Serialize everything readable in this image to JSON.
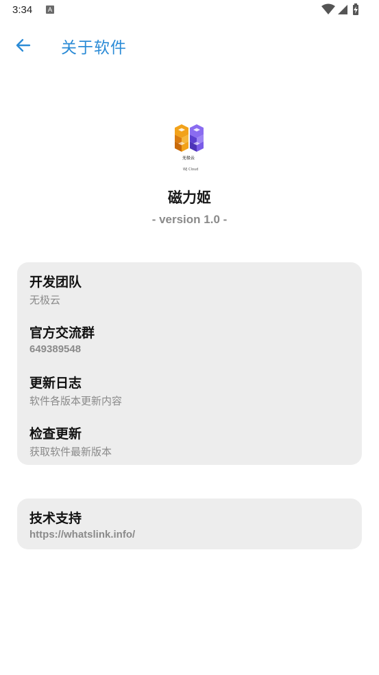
{
  "status": {
    "time": "3:34",
    "notification_icon": "A"
  },
  "header": {
    "title": "关于软件",
    "back_icon": "arrow-left-icon"
  },
  "app": {
    "logo_text_cn": "无极云",
    "logo_text_en": "WJ Cloud",
    "name": "磁力姬",
    "version": "- version 1.0 -"
  },
  "colors": {
    "accent": "#2b8bd6",
    "card_bg": "#ededed",
    "subtext": "#8a8a8a"
  },
  "card1": {
    "items": [
      {
        "title": "开发团队",
        "subtitle": "无极云"
      },
      {
        "title": "官方交流群",
        "subtitle": "649389548"
      },
      {
        "title": "更新日志",
        "subtitle": "软件各版本更新内容"
      },
      {
        "title": "检查更新",
        "subtitle": "获取软件最新版本"
      }
    ]
  },
  "card2": {
    "items": [
      {
        "title": "技术支持",
        "subtitle": "https://whatslink.info/"
      }
    ]
  }
}
